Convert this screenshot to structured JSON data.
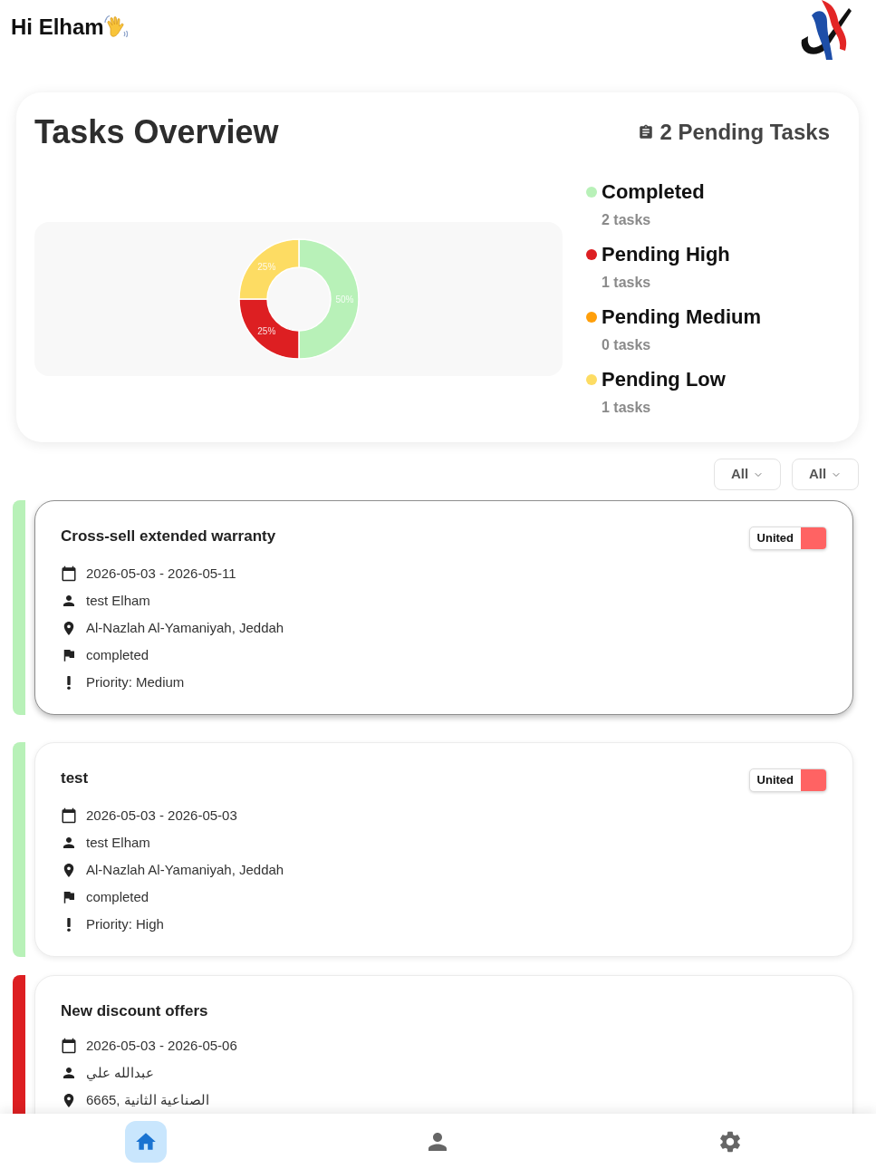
{
  "greeting": "Hi Elham",
  "overview": {
    "title": "Tasks Overview",
    "pending_summary": "2 Pending Tasks",
    "chart_data": {
      "type": "donut",
      "values": [
        50,
        25,
        25
      ],
      "colors": [
        "#b8f1b8",
        "#dd1f22",
        "#fddc63"
      ],
      "data_labels": true,
      "value_labels": [
        "50%",
        "25%",
        "25%"
      ]
    },
    "legend": [
      {
        "label": "Completed",
        "count": "2 tasks",
        "color": "#b8f1b8"
      },
      {
        "label": "Pending High",
        "count": "1 tasks",
        "color": "#dd1f22"
      },
      {
        "label": "Pending Medium",
        "count": "0 tasks",
        "color": "#ff9f0a"
      },
      {
        "label": "Pending Low",
        "count": "1 tasks",
        "color": "#fddc63"
      }
    ]
  },
  "filters": [
    "All",
    "All"
  ],
  "tasks": [
    {
      "title": "Cross-sell extended warranty",
      "selected": true,
      "color": "#b8f1b8",
      "badge": {
        "label": "United",
        "color": "#ff6363"
      },
      "details": [
        {
          "kind": "date",
          "text": "2026-05-03 - 2026-05-11"
        },
        {
          "kind": "person",
          "text": "test Elham"
        },
        {
          "kind": "location",
          "text": "Al-Nazlah Al-Yamaniyah, Jeddah"
        },
        {
          "kind": "status",
          "text": "completed"
        },
        {
          "kind": "priority",
          "text": "Priority: Medium"
        }
      ]
    },
    {
      "title": "test",
      "selected": false,
      "color": "#b8f1b8",
      "badge": {
        "label": "United",
        "color": "#ff6363"
      },
      "details": [
        {
          "kind": "date",
          "text": "2026-05-03 - 2026-05-03"
        },
        {
          "kind": "person",
          "text": "test Elham"
        },
        {
          "kind": "location",
          "text": "Al-Nazlah Al-Yamaniyah, Jeddah"
        },
        {
          "kind": "status",
          "text": "completed"
        },
        {
          "kind": "priority",
          "text": "Priority: High"
        }
      ]
    },
    {
      "title": "New discount offers",
      "selected": false,
      "color": "#dd1f22",
      "details": [
        {
          "kind": "date",
          "text": "2026-05-03 - 2026-05-06"
        },
        {
          "kind": "person",
          "text": "عبدالله علي"
        },
        {
          "kind": "location",
          "text": "6665, الصناعية الثانية"
        }
      ]
    }
  ],
  "bottom_nav": [
    {
      "kind": "home",
      "selected": true
    },
    {
      "kind": "profile",
      "selected": false
    },
    {
      "kind": "settings",
      "selected": false
    }
  ]
}
